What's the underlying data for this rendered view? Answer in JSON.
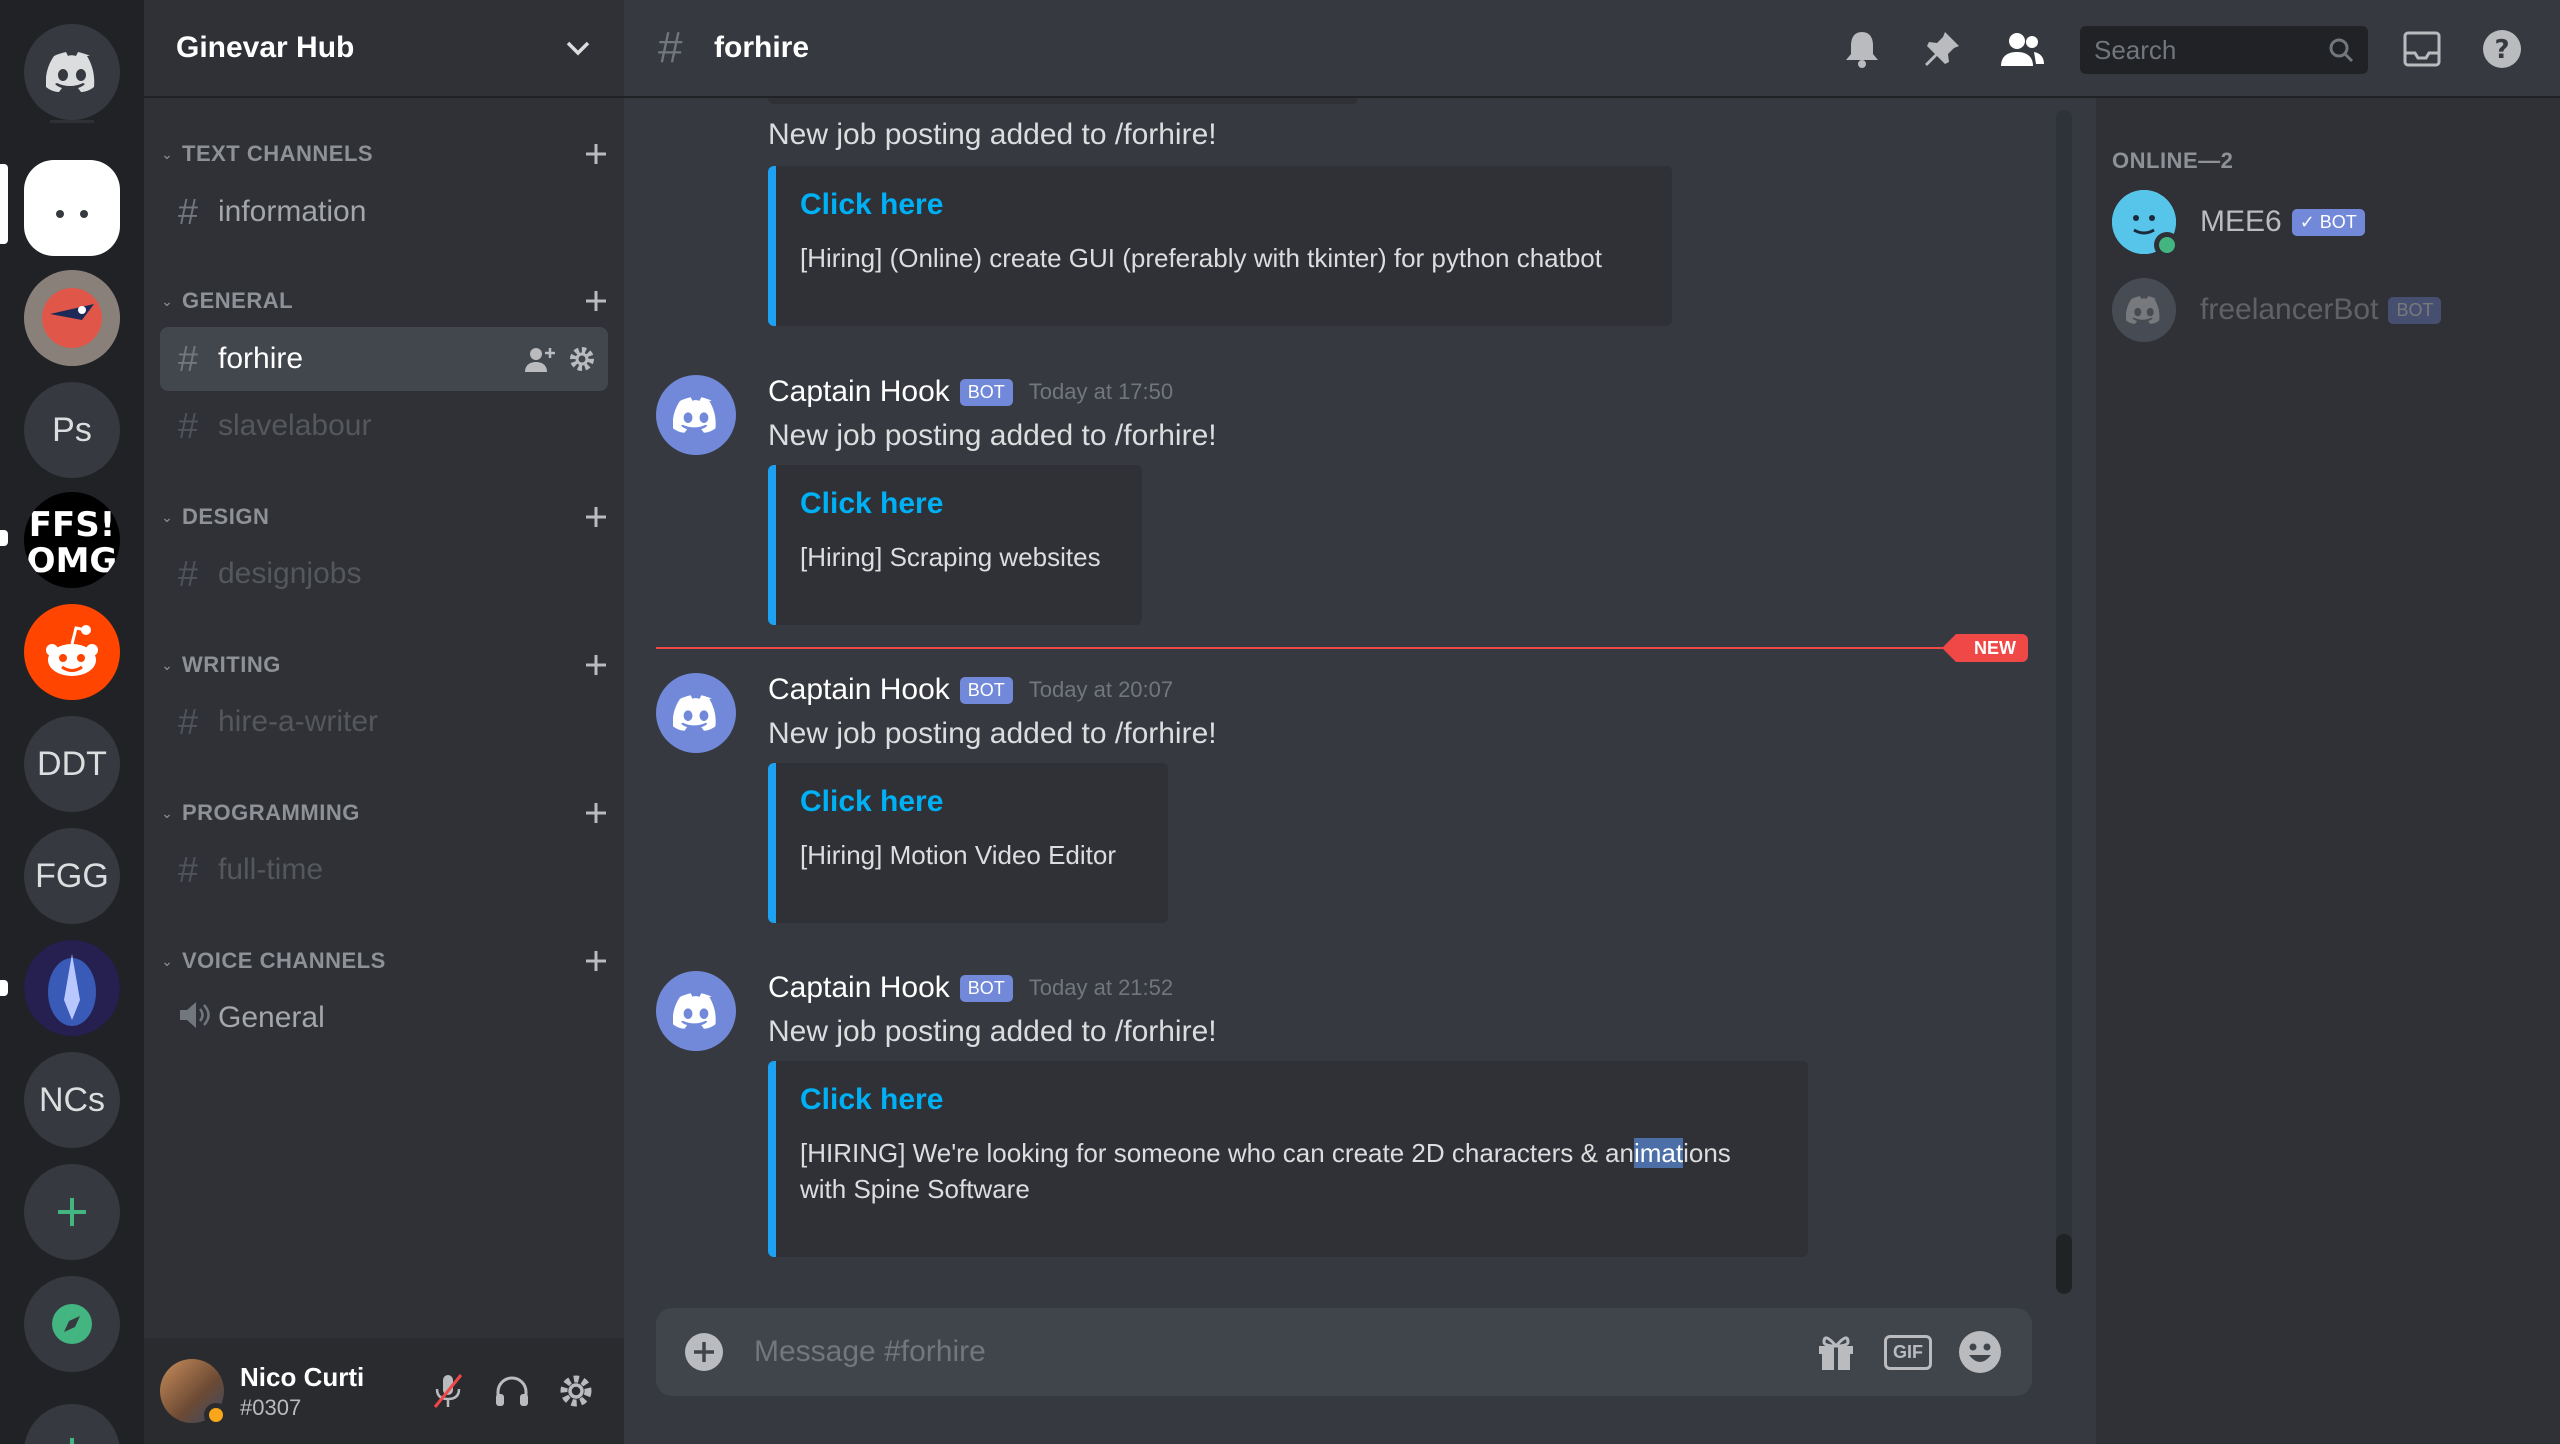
{
  "servers": [
    {
      "kind": "home",
      "label": ""
    },
    {
      "kind": "image",
      "label": ""
    },
    {
      "kind": "image",
      "label": ""
    },
    {
      "kind": "text",
      "label": "Ps"
    },
    {
      "kind": "image",
      "label": ""
    },
    {
      "kind": "image",
      "label": ""
    },
    {
      "kind": "text",
      "label": "DDT"
    },
    {
      "kind": "text",
      "label": "FGG"
    },
    {
      "kind": "image",
      "label": ""
    },
    {
      "kind": "text",
      "label": "NCs"
    }
  ],
  "guild": {
    "name": "Ginevar Hub"
  },
  "categories": [
    {
      "name": "TEXT CHANNELS",
      "channels": [
        "information"
      ]
    },
    {
      "name": "GENERAL",
      "channels": [
        "forhire",
        "slavelabour"
      ]
    },
    {
      "name": "DESIGN",
      "channels": [
        "designjobs"
      ]
    },
    {
      "name": "WRITING",
      "channels": [
        "hire-a-writer"
      ]
    },
    {
      "name": "PROGRAMMING",
      "channels": [
        "full-time"
      ]
    },
    {
      "name": "VOICE CHANNELS",
      "channels": [
        "General"
      ]
    }
  ],
  "user": {
    "name": "Nico Curti",
    "tag": "#0307"
  },
  "channel": {
    "title": "forhire"
  },
  "search": {
    "placeholder": "Search"
  },
  "messages": [
    {
      "author": "",
      "badge": "",
      "time": "",
      "text": "New job posting added to /forhire!",
      "embed": {
        "title": "Click here",
        "desc": "[Hiring] (Online) create GUI (preferably with tkinter) for python chatbot"
      }
    },
    {
      "author": "Captain Hook",
      "badge": "BOT",
      "time": "Today at 17:50",
      "text": "New job posting added to /forhire!",
      "embed": {
        "title": "Click here",
        "desc": "[Hiring] Scraping websites"
      }
    },
    {
      "author": "Captain Hook",
      "badge": "BOT",
      "time": "Today at 20:07",
      "text": "New job posting added to /forhire!",
      "embed": {
        "title": "Click here",
        "desc": "[Hiring] Motion Video Editor"
      }
    },
    {
      "author": "Captain Hook",
      "badge": "BOT",
      "time": "Today at 21:52",
      "text": "New job posting added to /forhire!",
      "embed": {
        "title": "Click here",
        "desc_before": "[HIRING] We're looking for someone who can create 2D characters & an",
        "desc_highlight": "imat",
        "desc_after": "ions",
        "desc_line2": "with Spine Software"
      }
    }
  ],
  "new_divider": {
    "label": "NEW"
  },
  "composer": {
    "placeholder": "Message #forhire",
    "gif_label": "GIF"
  },
  "members": {
    "header": "ONLINE—2",
    "list": [
      {
        "name": "MEE6",
        "badge": "✓ BOT",
        "status": "online"
      },
      {
        "name": "freelancerBot",
        "badge": "BOT",
        "status": "offline"
      }
    ]
  },
  "colors": {
    "blurple": "#7289da",
    "online": "#43b581",
    "idle": "#faa61a",
    "new_red": "#f04747",
    "link": "#00b0f4",
    "embed_bar": "#1da1f2"
  }
}
